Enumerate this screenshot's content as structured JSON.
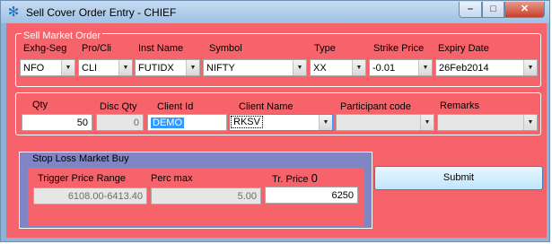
{
  "window": {
    "title": "Sell Cover Order Entry - CHIEF",
    "icon": "app-gear-icon"
  },
  "market_group": {
    "legend": "Sell Market Order",
    "fields": [
      {
        "label": "Exhg-Seg",
        "value": "NFO"
      },
      {
        "label": "Pro/Cli",
        "value": "CLI"
      },
      {
        "label": "Inst Name",
        "value": "FUTIDX"
      },
      {
        "label": "Symbol",
        "value": "NIFTY"
      },
      {
        "label": "Type",
        "value": "XX"
      },
      {
        "label": "Strike Price",
        "value": "-0.01"
      },
      {
        "label": "Expiry Date",
        "value": "26Feb2014"
      }
    ]
  },
  "order_group": {
    "qty_label": "Qty",
    "qty_value": "50",
    "disc_qty_label": "Disc Qty",
    "disc_qty_value": "0",
    "client_id_label": "Client Id",
    "client_id_value": "DEMO",
    "client_name_label": "Client Name",
    "client_name_value": "RKSV",
    "participant_label": "Participant code",
    "participant_value": "",
    "remarks_label": "Remarks",
    "remarks_value": ""
  },
  "stop_loss": {
    "title": "Stop Loss Market Buy",
    "trigger_label": "Trigger Price Range",
    "trigger_value": "6108.00-6413.40",
    "perc_label": "Perc max",
    "perc_value": "5.00",
    "price_label": "Tr. Price",
    "price_suffix": "0",
    "price_value": "6250"
  },
  "submit_label": "Submit"
}
